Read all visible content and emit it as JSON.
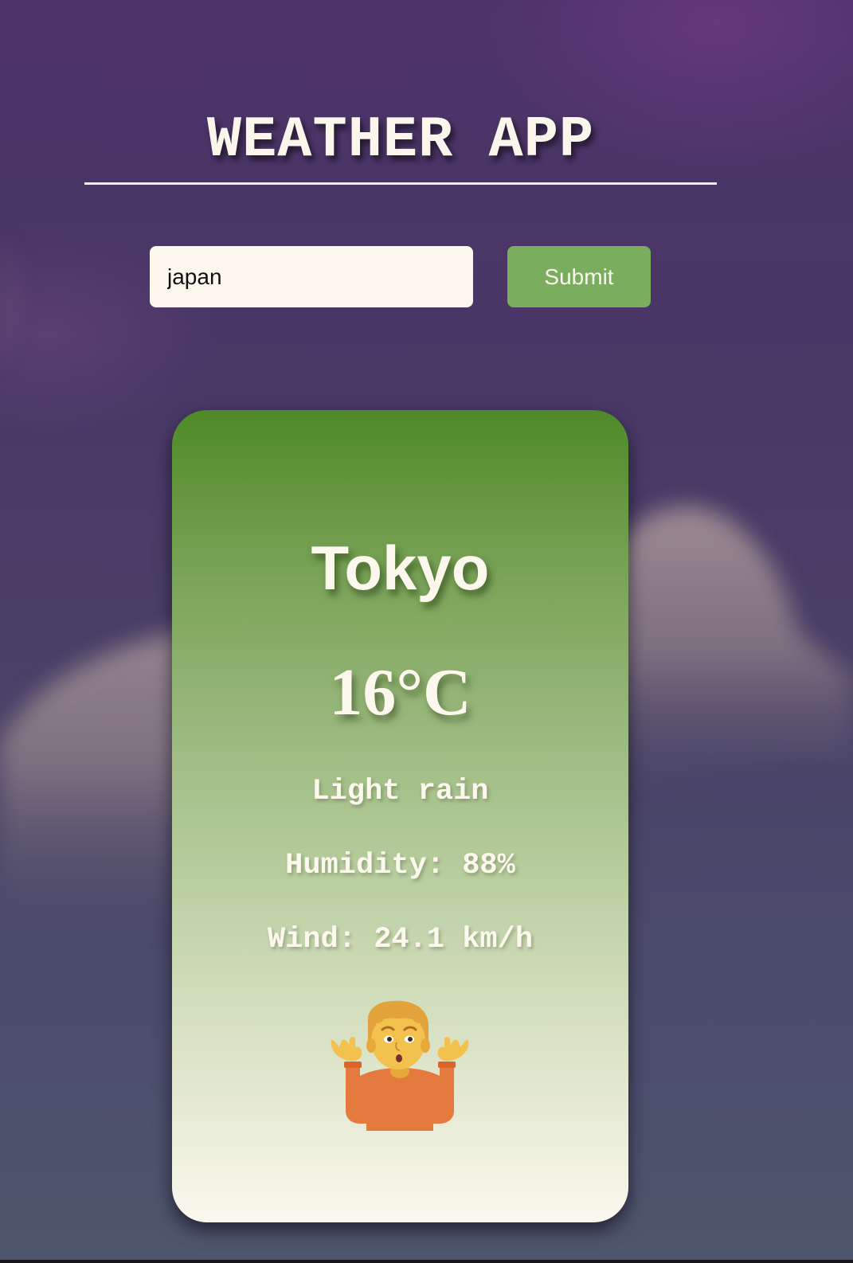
{
  "header": {
    "title": "WEATHER APP"
  },
  "search": {
    "value": "japan",
    "submit_label": "Submit"
  },
  "weather": {
    "city": "Tokyo",
    "temperature": "16°C",
    "description": "Light rain",
    "humidity": "Humidity: 88%",
    "wind": "Wind: 24.1 km/h",
    "icon": "person-shrugging-icon"
  },
  "colors": {
    "submit_button": "#7aad5e",
    "card_top": "#4f8a27",
    "card_bottom": "#fbf8ee",
    "text_light": "#fdf8ee"
  }
}
